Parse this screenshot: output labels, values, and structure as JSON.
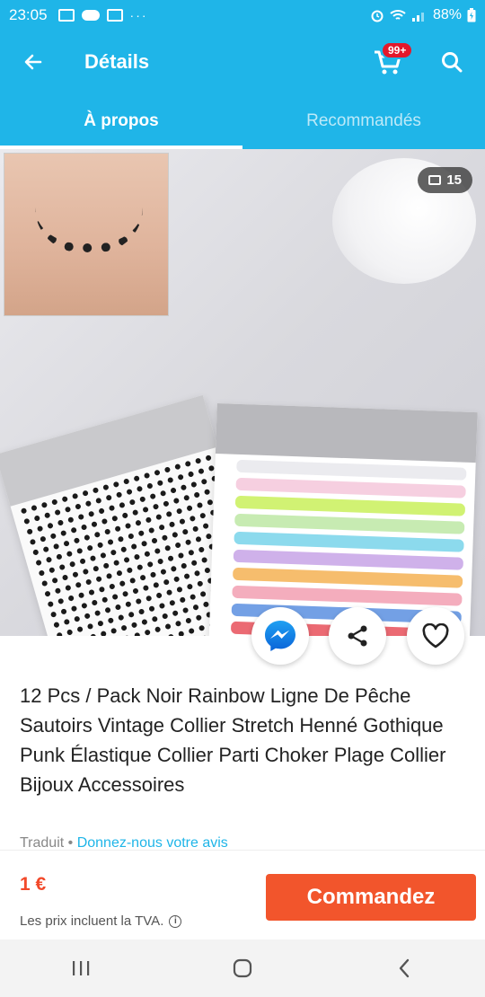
{
  "status_bar": {
    "time": "23:05",
    "dots": "···",
    "battery": "88%"
  },
  "app_bar": {
    "title": "Détails",
    "cart_badge": "99+"
  },
  "tabs": [
    {
      "label": "À propos",
      "active": true
    },
    {
      "label": "Recommandés",
      "active": false
    }
  ],
  "image": {
    "photo_count": "15",
    "band_colors": [
      "#e8e8ec",
      "#f4c7da",
      "#c9f05a",
      "#bde8a4",
      "#78d3ea",
      "#c7a3e6",
      "#f4b153",
      "#f29fb2",
      "#5b8fe0",
      "#e8505a",
      "#b38a7a",
      "#222222"
    ]
  },
  "product": {
    "title": "12 Pcs / Pack Noir Rainbow Ligne De Pêche Sautoirs Vintage Collier Stretch Henné Gothique Punk Élastique Collier Parti Choker Plage Collier Bijoux Accessoires",
    "translated_label": "Traduit • ",
    "feedback_link": "Donnez-nous votre avis"
  },
  "bottom_bar": {
    "price": "1 €",
    "vat_note": "Les prix incluent la TVA.",
    "order_button": "Commandez"
  },
  "colors": {
    "primary": "#1FB5E8",
    "order": "#F2552C",
    "price": "#F2492A",
    "badge": "#E4182B"
  }
}
